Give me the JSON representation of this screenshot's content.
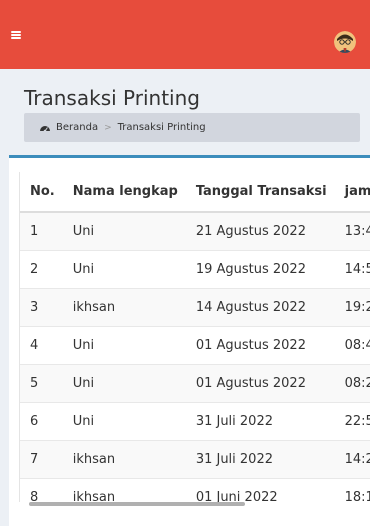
{
  "header": {
    "menu_icon": "hamburger-icon",
    "avatar_icon": "user-avatar-icon",
    "accent_color": "#e74c3c"
  },
  "page": {
    "title": "Transaksi Printing",
    "breadcrumb": {
      "home_icon": "dashboard-icon",
      "home_label": "Beranda",
      "separator": ">",
      "current_label": "Transaksi Printing"
    }
  },
  "table": {
    "columns": [
      "No.",
      "Nama lengkap",
      "Tanggal Transaksi",
      "jam"
    ],
    "rows": [
      {
        "no": "1",
        "nama": "Uni",
        "tanggal": "21 Agustus 2022",
        "jam": "13:4"
      },
      {
        "no": "2",
        "nama": "Uni",
        "tanggal": "19 Agustus 2022",
        "jam": "14:5"
      },
      {
        "no": "3",
        "nama": "ikhsan",
        "tanggal": "14 Agustus 2022",
        "jam": "19:2"
      },
      {
        "no": "4",
        "nama": "Uni",
        "tanggal": "01 Agustus 2022",
        "jam": "08:4"
      },
      {
        "no": "5",
        "nama": "Uni",
        "tanggal": "01 Agustus 2022",
        "jam": "08:2"
      },
      {
        "no": "6",
        "nama": "Uni",
        "tanggal": "31 Juli 2022",
        "jam": "22:5"
      },
      {
        "no": "7",
        "nama": "ikhsan",
        "tanggal": "31 Juli 2022",
        "jam": "14:2"
      },
      {
        "no": "8",
        "nama": "ikhsan",
        "tanggal": "01 Juni 2022",
        "jam": "18:1"
      }
    ]
  }
}
